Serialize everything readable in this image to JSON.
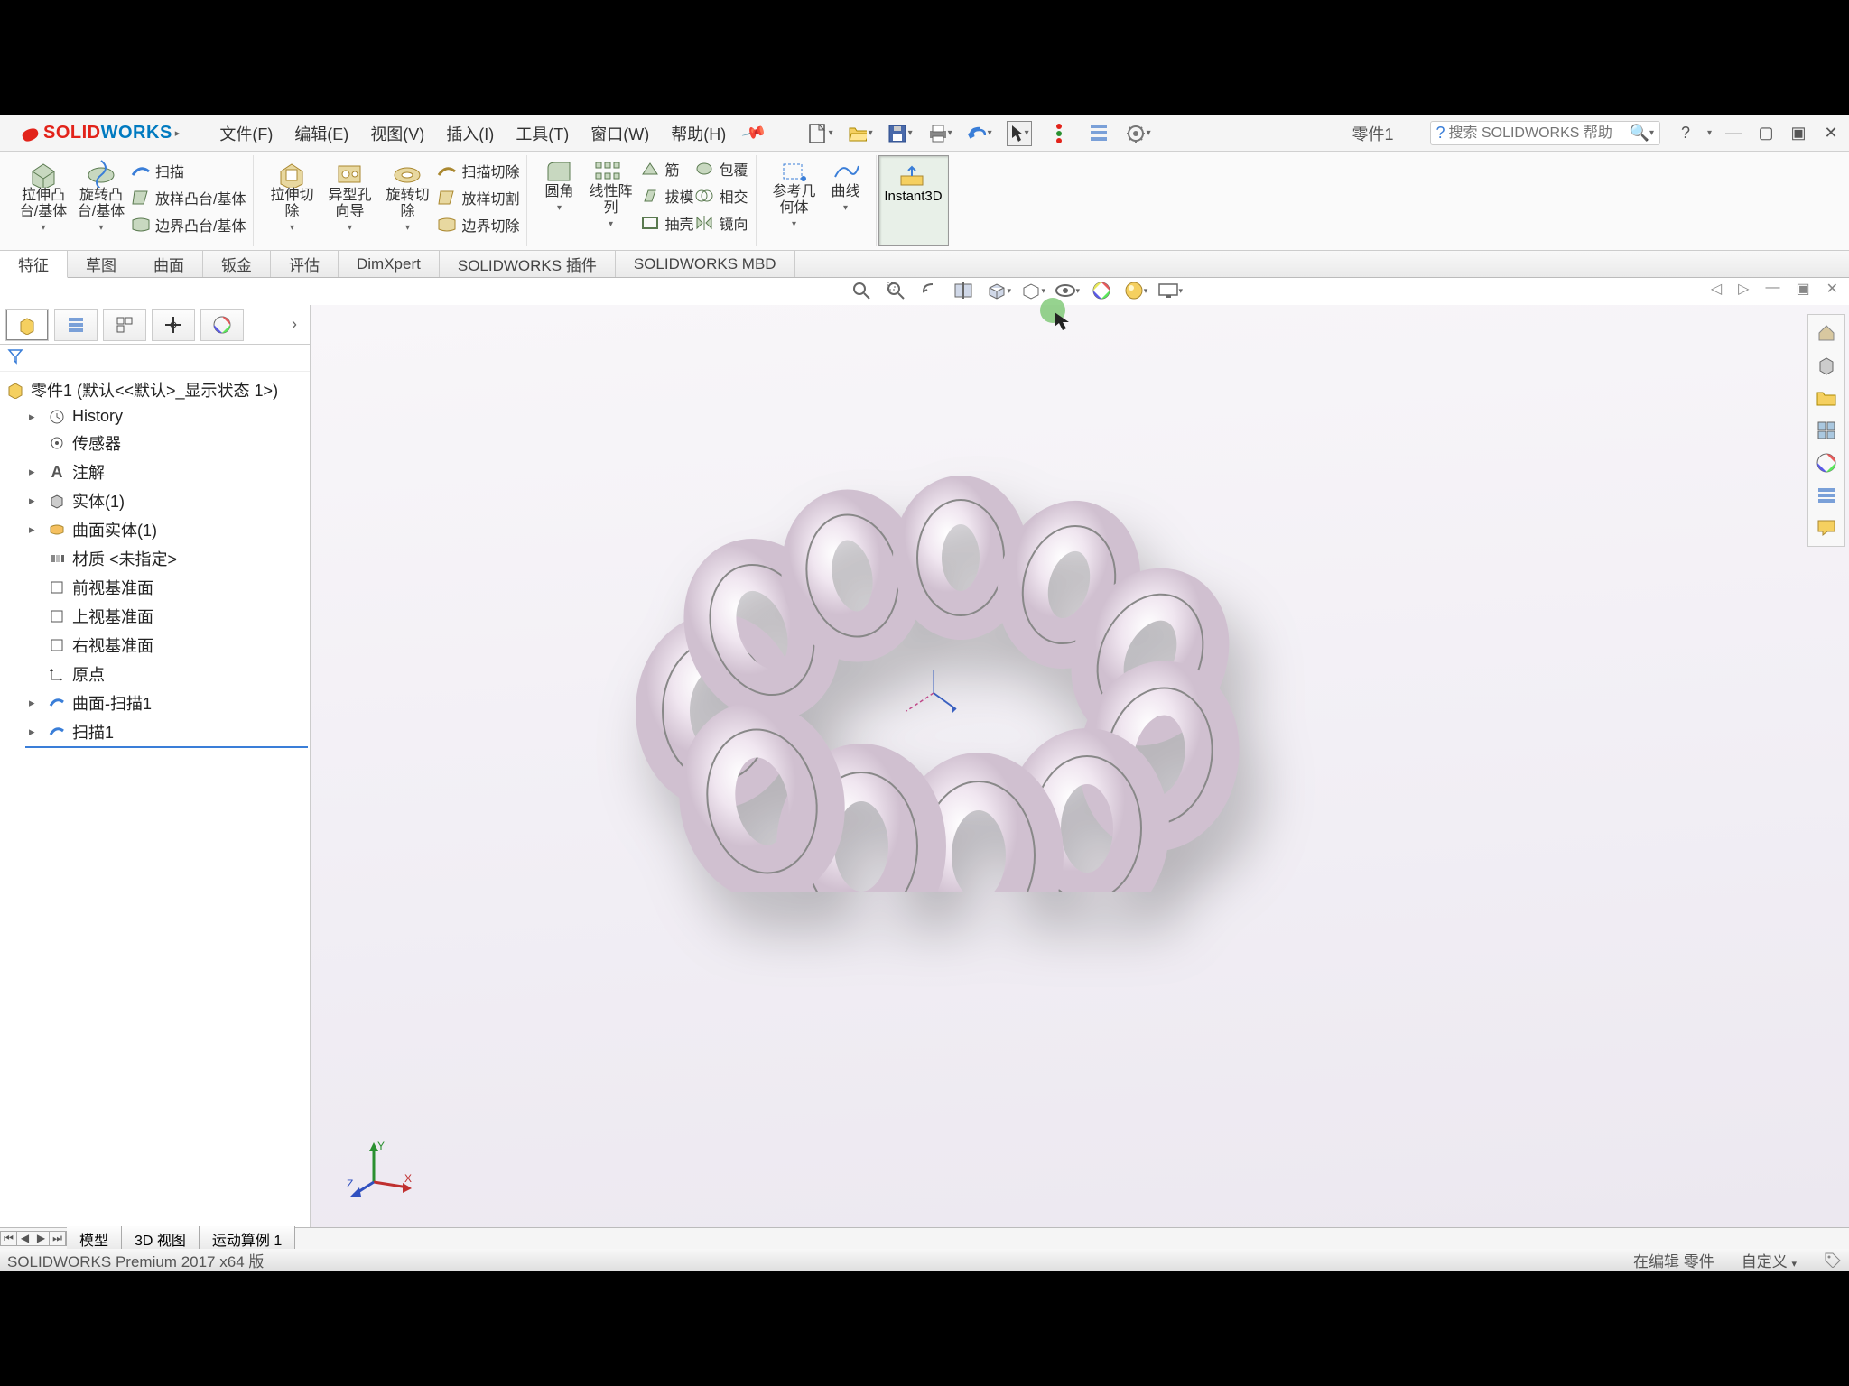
{
  "app": {
    "logo_solid": "SOLID",
    "logo_works": "WORKS",
    "doc_title": "零件1",
    "search_placeholder": "搜索 SOLIDWORKS 帮助"
  },
  "menu": [
    "文件(F)",
    "编辑(E)",
    "视图(V)",
    "插入(I)",
    "工具(T)",
    "窗口(W)",
    "帮助(H)"
  ],
  "ribbon": {
    "extrude": "拉伸凸台/基体",
    "revolve": "旋转凸台/基体",
    "sweep": "扫描",
    "loft": "放样凸台/基体",
    "boundary": "边界凸台/基体",
    "extrude_cut": "拉伸切除",
    "hole_wizard": "异型孔向导",
    "revolve_cut": "旋转切除",
    "sweep_cut": "扫描切除",
    "loft_cut": "放样切割",
    "boundary_cut": "边界切除",
    "fillet": "圆角",
    "linear_pattern": "线性阵列",
    "rib": "筋",
    "draft": "拔模",
    "shell": "抽壳",
    "wrap": "包覆",
    "intersect": "相交",
    "mirror": "镜向",
    "ref_geom": "参考几何体",
    "curves": "曲线",
    "instant3d": "Instant3D"
  },
  "ribbon_tabs": [
    "特征",
    "草图",
    "曲面",
    "钣金",
    "评估",
    "DimXpert",
    "SOLIDWORKS 插件",
    "SOLIDWORKS MBD"
  ],
  "tree": {
    "root": "零件1 (默认<<默认>_显示状态 1>)",
    "history": "History",
    "sensors": "传感器",
    "annotations": "注解",
    "solid_bodies": "实体(1)",
    "surface_bodies": "曲面实体(1)",
    "material": "材质 <未指定>",
    "front_plane": "前视基准面",
    "top_plane": "上视基准面",
    "right_plane": "右视基准面",
    "origin": "原点",
    "surf_sweep": "曲面-扫描1",
    "sweep1": "扫描1"
  },
  "bottom_tabs": [
    "模型",
    "3D 视图",
    "运动算例 1"
  ],
  "status": {
    "version": "SOLIDWORKS Premium 2017 x64 版",
    "editing": "在编辑 零件",
    "custom": "自定义"
  }
}
